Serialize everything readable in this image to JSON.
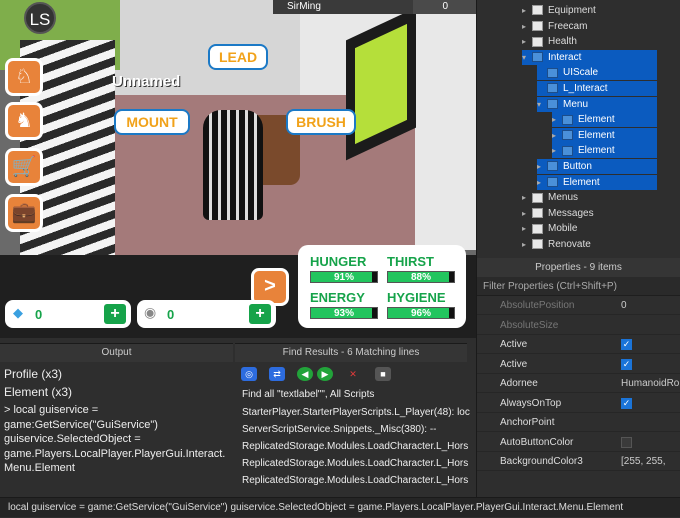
{
  "viewport": {
    "ls_label": "LS",
    "player_name": "SirMing",
    "player_value": "0",
    "unnamed_label": "Unnamed",
    "tags": {
      "lead": "LEAD",
      "mount": "MOUNT",
      "brush": "BRUSH"
    },
    "stats": [
      {
        "label": "HUNGER",
        "value": "91%",
        "fill": 0.91
      },
      {
        "label": "THIRST",
        "value": "88%",
        "fill": 0.88
      },
      {
        "label": "ENERGY",
        "value": "93%",
        "fill": 0.93
      },
      {
        "label": "HYGIENE",
        "value": "96%",
        "fill": 0.96
      }
    ],
    "gems_value": "0",
    "coins_value": "0",
    "arrow_label": ">"
  },
  "explorer": {
    "rows": [
      {
        "label": "Equipment",
        "icon": "folder",
        "selected": false
      },
      {
        "label": "Freecam",
        "icon": "folder",
        "selected": false
      },
      {
        "label": "Health",
        "icon": "folder",
        "selected": false
      },
      {
        "label": "Interact",
        "icon": "screen-gui",
        "selected": true
      },
      {
        "label": "UIScale",
        "icon": "ui-scale",
        "selected": true
      },
      {
        "label": "L_Interact",
        "icon": "local-script",
        "selected": true
      },
      {
        "label": "Menu",
        "icon": "frame",
        "selected": true
      },
      {
        "label": "Element",
        "icon": "image-button",
        "selected": true
      },
      {
        "label": "Element",
        "icon": "image-button",
        "selected": true
      },
      {
        "label": "Element",
        "icon": "image-button",
        "selected": true
      },
      {
        "label": "Button",
        "icon": "text-button",
        "selected": true
      },
      {
        "label": "Element",
        "icon": "image-button",
        "selected": true
      },
      {
        "label": "Menus",
        "icon": "folder",
        "selected": false
      },
      {
        "label": "Messages",
        "icon": "folder",
        "selected": false
      },
      {
        "label": "Mobile",
        "icon": "folder",
        "selected": false
      },
      {
        "label": "Renovate",
        "icon": "folder",
        "selected": false
      }
    ]
  },
  "properties": {
    "title": "Properties - 9 items",
    "filter_placeholder": "Filter Properties (Ctrl+Shift+P)",
    "rows": [
      {
        "name": "AbsolutePosition",
        "value": "0",
        "dim": true
      },
      {
        "name": "AbsoluteSize",
        "value": "",
        "dim": true
      },
      {
        "name": "Active",
        "value": "checked",
        "dim": false
      },
      {
        "name": "Active",
        "value": "checked",
        "dim": false
      },
      {
        "name": "Adornee",
        "value": "HumanoidRo",
        "dim": false
      },
      {
        "name": "AlwaysOnTop",
        "value": "checked",
        "dim": false
      },
      {
        "name": "AnchorPoint",
        "value": "",
        "dim": false
      },
      {
        "name": "AutoButtonColor",
        "value": "unchecked",
        "dim": false
      },
      {
        "name": "BackgroundColor3",
        "value": "[255, 255,",
        "dim": false
      }
    ]
  },
  "output": {
    "title": "Output",
    "lines": [
      "Profile (x3)",
      "Element (x3)",
      "> local guiservice =",
      "game:GetService(\"GuiService\")",
      "guiservice.SelectedObject =",
      "game.Players.LocalPlayer.PlayerGui.Interact.",
      "Menu.Element"
    ]
  },
  "find": {
    "title": "Find Results - 6 Matching lines",
    "header": "Find all \"textlabel\"\", All Scripts",
    "lines": [
      "StarterPlayer.StarterPlayerScripts.L_Player(48): loc",
      "ServerScriptService.Snippets._Misc(380): --",
      "ReplicatedStorage.Modules.LoadCharacter.L_Hors",
      "ReplicatedStorage.Modules.LoadCharacter.L_Hors",
      "ReplicatedStorage.Modules.LoadCharacter.L_Hors"
    ]
  },
  "command_bar": {
    "text": "local guiservice = game:GetService(\"GuiService\")  guiservice.SelectedObject = game.Players.LocalPlayer.PlayerGui.Interact.Menu.Element"
  }
}
